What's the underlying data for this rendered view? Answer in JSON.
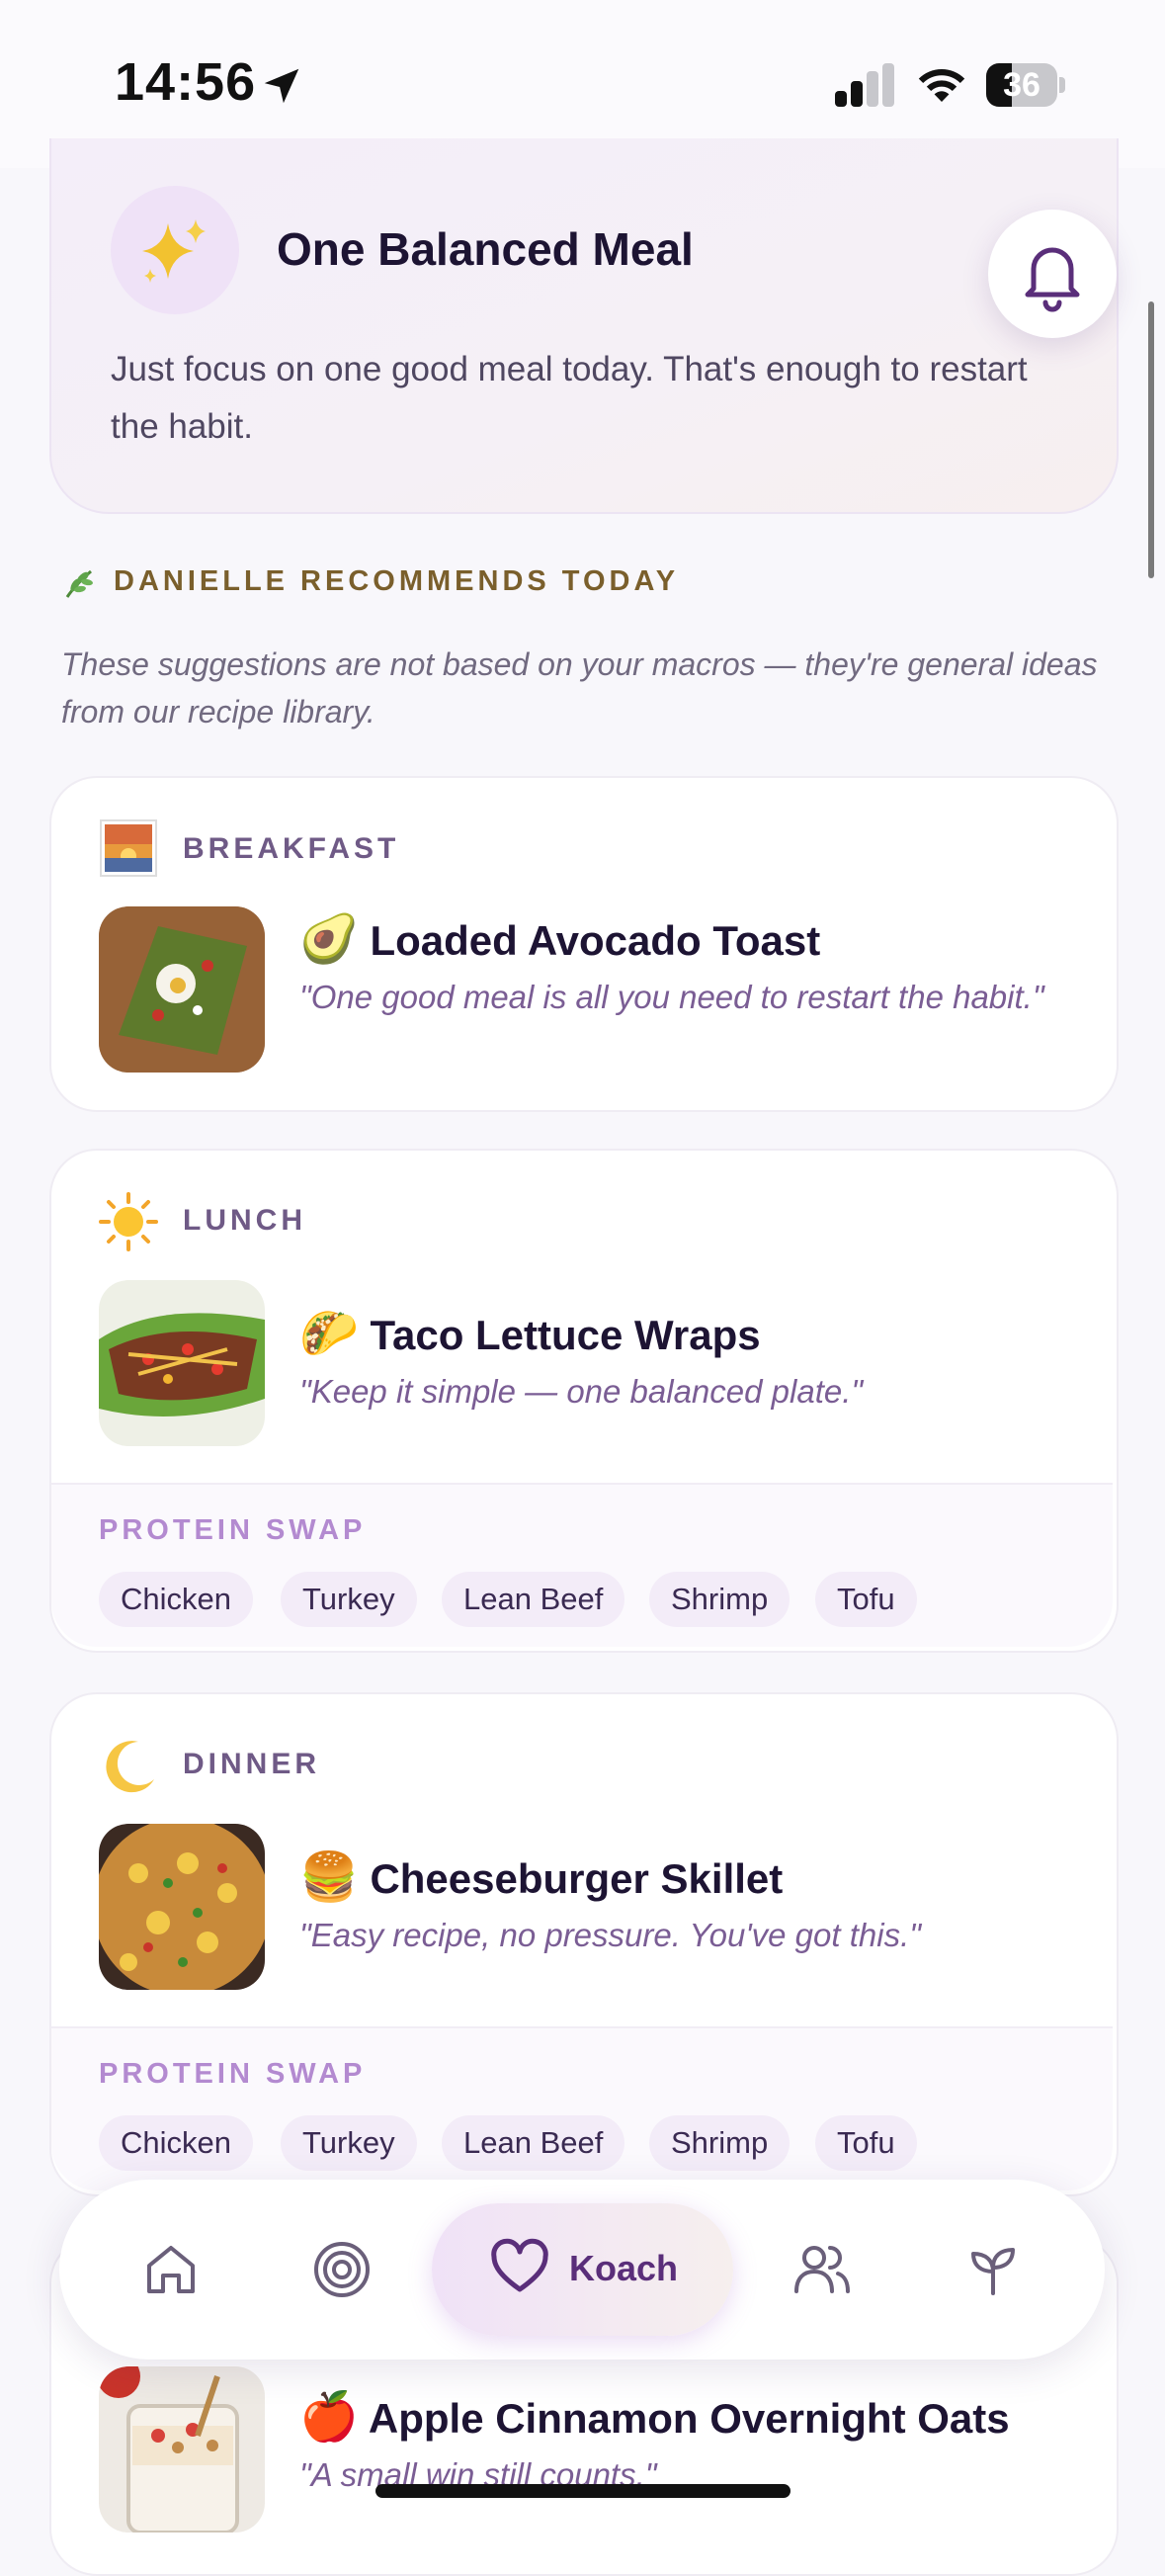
{
  "status_bar": {
    "time": "14:56",
    "battery": "36",
    "battery_level": 0.36
  },
  "hero": {
    "title": "One Balanced Meal",
    "text": "Just focus on one good meal today. That's enough to restart the habit."
  },
  "recommendations": {
    "heading": "DANIELLE RECOMMENDS TODAY",
    "disclaimer": "These suggestions are not based on your macros — they're general ideas from our recipe library.",
    "meals": [
      {
        "label": "BREAKFAST",
        "emoji": "🥑",
        "title": "Loaded Avocado Toast",
        "quote": "\"One good meal is all you need to restart the habit.\""
      },
      {
        "label": "LUNCH",
        "emoji": "🌮",
        "title": "Taco Lettuce Wraps",
        "quote": "\"Keep it simple — one balanced plate.\""
      },
      {
        "label": "DINNER",
        "emoji": "🍔",
        "title": "Cheeseburger Skillet",
        "quote": "\"Easy recipe, no pressure. You've got this.\""
      },
      {
        "label": "",
        "emoji": "🍎",
        "title": "Apple Cinnamon Overnight Oats",
        "quote": "\"A small win still counts.\""
      }
    ],
    "swap_label": "PROTEIN SWAP",
    "proteins": [
      "Chicken",
      "Turkey",
      "Lean Beef",
      "Shrimp",
      "Tofu"
    ]
  },
  "tabbar": {
    "active": "Koach",
    "items": [
      {
        "icon": "home-icon"
      },
      {
        "icon": "target-icon"
      },
      {
        "icon": "heart-icon",
        "label": "Koach"
      },
      {
        "icon": "community-icon"
      },
      {
        "icon": "sprout-icon"
      }
    ]
  },
  "colors": {
    "accent": "#5a2e7a",
    "chip_bg": "#f3ecf8",
    "swap_label": "#b38ad0"
  }
}
